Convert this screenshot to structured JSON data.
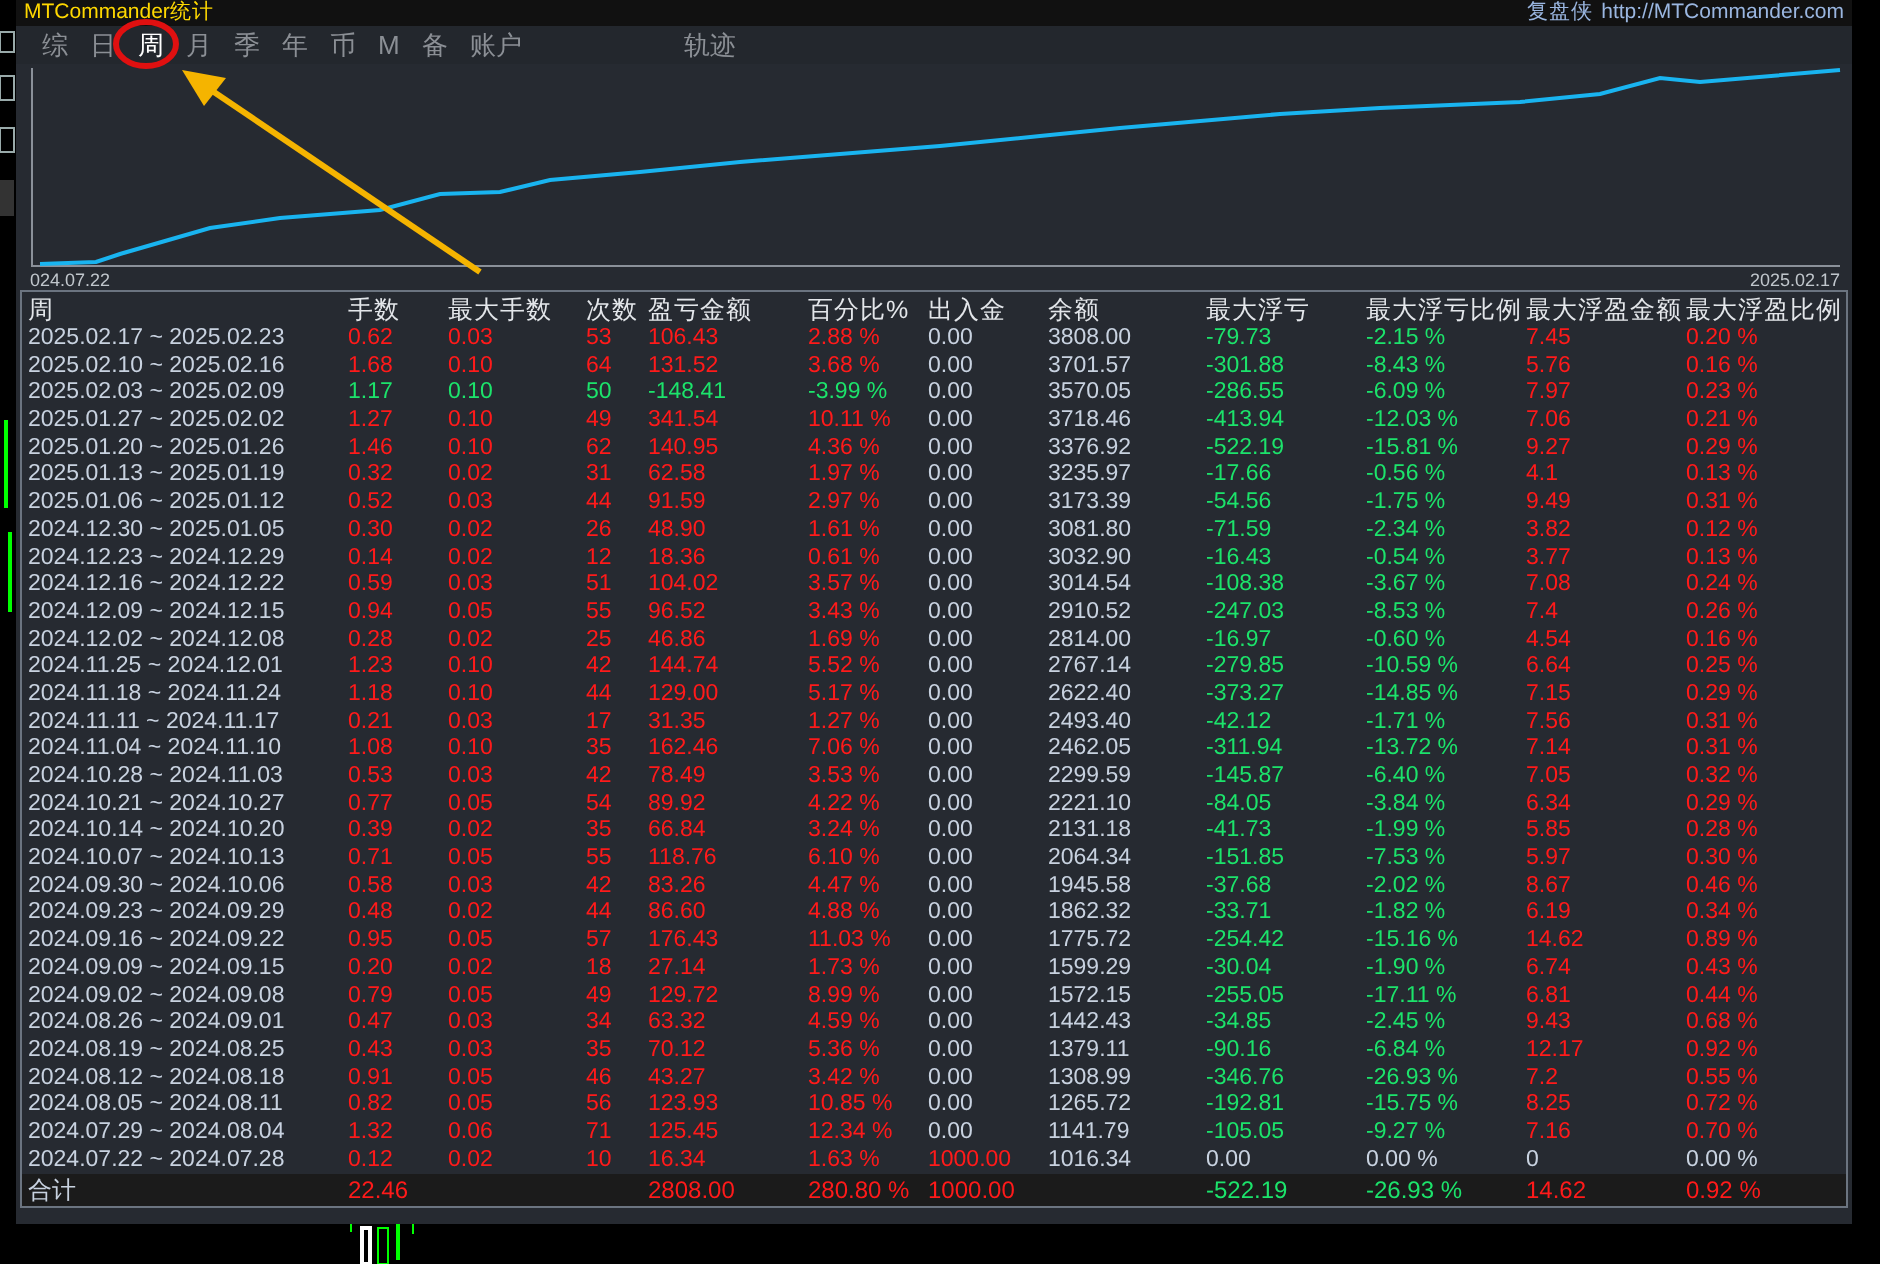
{
  "title": "MTCommander统计",
  "site": {
    "name": "复盘侠",
    "url": "http://MTCommander.com"
  },
  "tabs": [
    {
      "label": "综",
      "selected": false
    },
    {
      "label": "日",
      "selected": false
    },
    {
      "label": "周",
      "selected": true
    },
    {
      "label": "月",
      "selected": false
    },
    {
      "label": "季",
      "selected": false
    },
    {
      "label": "年",
      "selected": false
    },
    {
      "label": "币",
      "selected": false
    },
    {
      "label": "M",
      "selected": false
    },
    {
      "label": "备",
      "selected": false
    },
    {
      "label": "账户",
      "selected": false
    },
    {
      "label": "轨迹",
      "selected": false
    }
  ],
  "chart": {
    "start_label": "024.07.22",
    "end_label": "2025.02.17"
  },
  "table": {
    "columns": [
      "周",
      "手数",
      "最大手数",
      "次数",
      "盈亏金额",
      "百分比%",
      "出入金",
      "余额",
      "最大浮亏",
      "最大浮亏比例",
      "最大浮盈金额",
      "最大浮盈比例"
    ],
    "rows": [
      {
        "kind": "gain",
        "cells": [
          "2025.02.17 ~ 2025.02.23",
          "0.62",
          "0.03",
          "53",
          "106.43",
          "2.88 %",
          "0.00",
          "3808.00",
          "-79.73",
          "-2.15 %",
          "7.45",
          "0.20 %"
        ]
      },
      {
        "kind": "gain",
        "cells": [
          "2025.02.10 ~ 2025.02.16",
          "1.68",
          "0.10",
          "64",
          "131.52",
          "3.68 %",
          "0.00",
          "3701.57",
          "-301.88",
          "-8.43 %",
          "5.76",
          "0.16 %"
        ]
      },
      {
        "kind": "loss",
        "cells": [
          "2025.02.03 ~ 2025.02.09",
          "1.17",
          "0.10",
          "50",
          "-148.41",
          "-3.99 %",
          "0.00",
          "3570.05",
          "-286.55",
          "-6.09 %",
          "7.97",
          "0.23 %"
        ]
      },
      {
        "kind": "gain",
        "cells": [
          "2025.01.27 ~ 2025.02.02",
          "1.27",
          "0.10",
          "49",
          "341.54",
          "10.11 %",
          "0.00",
          "3718.46",
          "-413.94",
          "-12.03 %",
          "7.06",
          "0.21 %"
        ]
      },
      {
        "kind": "gain",
        "cells": [
          "2025.01.20 ~ 2025.01.26",
          "1.46",
          "0.10",
          "62",
          "140.95",
          "4.36 %",
          "0.00",
          "3376.92",
          "-522.19",
          "-15.81 %",
          "9.27",
          "0.29 %"
        ]
      },
      {
        "kind": "gain",
        "cells": [
          "2025.01.13 ~ 2025.01.19",
          "0.32",
          "0.02",
          "31",
          "62.58",
          "1.97 %",
          "0.00",
          "3235.97",
          "-17.66",
          "-0.56 %",
          "4.1",
          "0.13 %"
        ]
      },
      {
        "kind": "gain",
        "cells": [
          "2025.01.06 ~ 2025.01.12",
          "0.52",
          "0.03",
          "44",
          "91.59",
          "2.97 %",
          "0.00",
          "3173.39",
          "-54.56",
          "-1.75 %",
          "9.49",
          "0.31 %"
        ]
      },
      {
        "kind": "gain",
        "cells": [
          "2024.12.30 ~ 2025.01.05",
          "0.30",
          "0.02",
          "26",
          "48.90",
          "1.61 %",
          "0.00",
          "3081.80",
          "-71.59",
          "-2.34 %",
          "3.82",
          "0.12 %"
        ]
      },
      {
        "kind": "gain",
        "cells": [
          "2024.12.23 ~ 2024.12.29",
          "0.14",
          "0.02",
          "12",
          "18.36",
          "0.61 %",
          "0.00",
          "3032.90",
          "-16.43",
          "-0.54 %",
          "3.77",
          "0.13 %"
        ]
      },
      {
        "kind": "gain",
        "cells": [
          "2024.12.16 ~ 2024.12.22",
          "0.59",
          "0.03",
          "51",
          "104.02",
          "3.57 %",
          "0.00",
          "3014.54",
          "-108.38",
          "-3.67 %",
          "7.08",
          "0.24 %"
        ]
      },
      {
        "kind": "gain",
        "cells": [
          "2024.12.09 ~ 2024.12.15",
          "0.94",
          "0.05",
          "55",
          "96.52",
          "3.43 %",
          "0.00",
          "2910.52",
          "-247.03",
          "-8.53 %",
          "7.4",
          "0.26 %"
        ]
      },
      {
        "kind": "gain",
        "cells": [
          "2024.12.02 ~ 2024.12.08",
          "0.28",
          "0.02",
          "25",
          "46.86",
          "1.69 %",
          "0.00",
          "2814.00",
          "-16.97",
          "-0.60 %",
          "4.54",
          "0.16 %"
        ]
      },
      {
        "kind": "gain",
        "cells": [
          "2024.11.25 ~ 2024.12.01",
          "1.23",
          "0.10",
          "42",
          "144.74",
          "5.52 %",
          "0.00",
          "2767.14",
          "-279.85",
          "-10.59 %",
          "6.64",
          "0.25 %"
        ]
      },
      {
        "kind": "gain",
        "cells": [
          "2024.11.18 ~ 2024.11.24",
          "1.18",
          "0.10",
          "44",
          "129.00",
          "5.17 %",
          "0.00",
          "2622.40",
          "-373.27",
          "-14.85 %",
          "7.15",
          "0.29 %"
        ]
      },
      {
        "kind": "gain",
        "cells": [
          "2024.11.11 ~ 2024.11.17",
          "0.21",
          "0.03",
          "17",
          "31.35",
          "1.27 %",
          "0.00",
          "2493.40",
          "-42.12",
          "-1.71 %",
          "7.56",
          "0.31 %"
        ]
      },
      {
        "kind": "gain",
        "cells": [
          "2024.11.04 ~ 2024.11.10",
          "1.08",
          "0.10",
          "35",
          "162.46",
          "7.06 %",
          "0.00",
          "2462.05",
          "-311.94",
          "-13.72 %",
          "7.14",
          "0.31 %"
        ]
      },
      {
        "kind": "gain",
        "cells": [
          "2024.10.28 ~ 2024.11.03",
          "0.53",
          "0.03",
          "42",
          "78.49",
          "3.53 %",
          "0.00",
          "2299.59",
          "-145.87",
          "-6.40 %",
          "7.05",
          "0.32 %"
        ]
      },
      {
        "kind": "gain",
        "cells": [
          "2024.10.21 ~ 2024.10.27",
          "0.77",
          "0.05",
          "54",
          "89.92",
          "4.22 %",
          "0.00",
          "2221.10",
          "-84.05",
          "-3.84 %",
          "6.34",
          "0.29 %"
        ]
      },
      {
        "kind": "gain",
        "cells": [
          "2024.10.14 ~ 2024.10.20",
          "0.39",
          "0.02",
          "35",
          "66.84",
          "3.24 %",
          "0.00",
          "2131.18",
          "-41.73",
          "-1.99 %",
          "5.85",
          "0.28 %"
        ]
      },
      {
        "kind": "gain",
        "cells": [
          "2024.10.07 ~ 2024.10.13",
          "0.71",
          "0.05",
          "55",
          "118.76",
          "6.10 %",
          "0.00",
          "2064.34",
          "-151.85",
          "-7.53 %",
          "5.97",
          "0.30 %"
        ]
      },
      {
        "kind": "gain",
        "cells": [
          "2024.09.30 ~ 2024.10.06",
          "0.58",
          "0.03",
          "42",
          "83.26",
          "4.47 %",
          "0.00",
          "1945.58",
          "-37.68",
          "-2.02 %",
          "8.67",
          "0.46 %"
        ]
      },
      {
        "kind": "gain",
        "cells": [
          "2024.09.23 ~ 2024.09.29",
          "0.48",
          "0.02",
          "44",
          "86.60",
          "4.88 %",
          "0.00",
          "1862.32",
          "-33.71",
          "-1.82 %",
          "6.19",
          "0.34 %"
        ]
      },
      {
        "kind": "gain",
        "cells": [
          "2024.09.16 ~ 2024.09.22",
          "0.95",
          "0.05",
          "57",
          "176.43",
          "11.03 %",
          "0.00",
          "1775.72",
          "-254.42",
          "-15.16 %",
          "14.62",
          "0.89 %"
        ]
      },
      {
        "kind": "gain",
        "cells": [
          "2024.09.09 ~ 2024.09.15",
          "0.20",
          "0.02",
          "18",
          "27.14",
          "1.73 %",
          "0.00",
          "1599.29",
          "-30.04",
          "-1.90 %",
          "6.74",
          "0.43 %"
        ]
      },
      {
        "kind": "gain",
        "cells": [
          "2024.09.02 ~ 2024.09.08",
          "0.79",
          "0.05",
          "49",
          "129.72",
          "8.99 %",
          "0.00",
          "1572.15",
          "-255.05",
          "-17.11 %",
          "6.81",
          "0.44 %"
        ]
      },
      {
        "kind": "gain",
        "cells": [
          "2024.08.26 ~ 2024.09.01",
          "0.47",
          "0.03",
          "34",
          "63.32",
          "4.59 %",
          "0.00",
          "1442.43",
          "-34.85",
          "-2.45 %",
          "9.43",
          "0.68 %"
        ]
      },
      {
        "kind": "gain",
        "cells": [
          "2024.08.19 ~ 2024.08.25",
          "0.43",
          "0.03",
          "35",
          "70.12",
          "5.36 %",
          "0.00",
          "1379.11",
          "-90.16",
          "-6.84 %",
          "12.17",
          "0.92 %"
        ]
      },
      {
        "kind": "gain",
        "cells": [
          "2024.08.12 ~ 2024.08.18",
          "0.91",
          "0.05",
          "46",
          "43.27",
          "3.42 %",
          "0.00",
          "1308.99",
          "-346.76",
          "-26.93 %",
          "7.2",
          "0.55 %"
        ]
      },
      {
        "kind": "gain",
        "cells": [
          "2024.08.05 ~ 2024.08.11",
          "0.82",
          "0.05",
          "56",
          "123.93",
          "10.85 %",
          "0.00",
          "1265.72",
          "-192.81",
          "-15.75 %",
          "8.25",
          "0.72 %"
        ]
      },
      {
        "kind": "gain",
        "cells": [
          "2024.07.29 ~ 2024.08.04",
          "1.32",
          "0.06",
          "71",
          "125.45",
          "12.34 %",
          "0.00",
          "1141.79",
          "-105.05",
          "-9.27 %",
          "7.16",
          "0.70 %"
        ]
      },
      {
        "kind": "deposit",
        "cells": [
          "2024.07.22 ~ 2024.07.28",
          "0.12",
          "0.02",
          "10",
          "16.34",
          "1.63 %",
          "1000.00",
          "1016.34",
          "0.00",
          "0.00 %",
          "0",
          "0.00 %"
        ]
      }
    ],
    "total": {
      "label": "合计",
      "lots": "22.46",
      "profit": "2808.00",
      "percent": "280.80 %",
      "deposit": "1000.00",
      "max_float_loss": "-522.19",
      "max_float_loss_ratio": "-26.93 %",
      "max_float_profit": "14.62",
      "max_float_profit_ratio": "0.92 %"
    }
  }
}
